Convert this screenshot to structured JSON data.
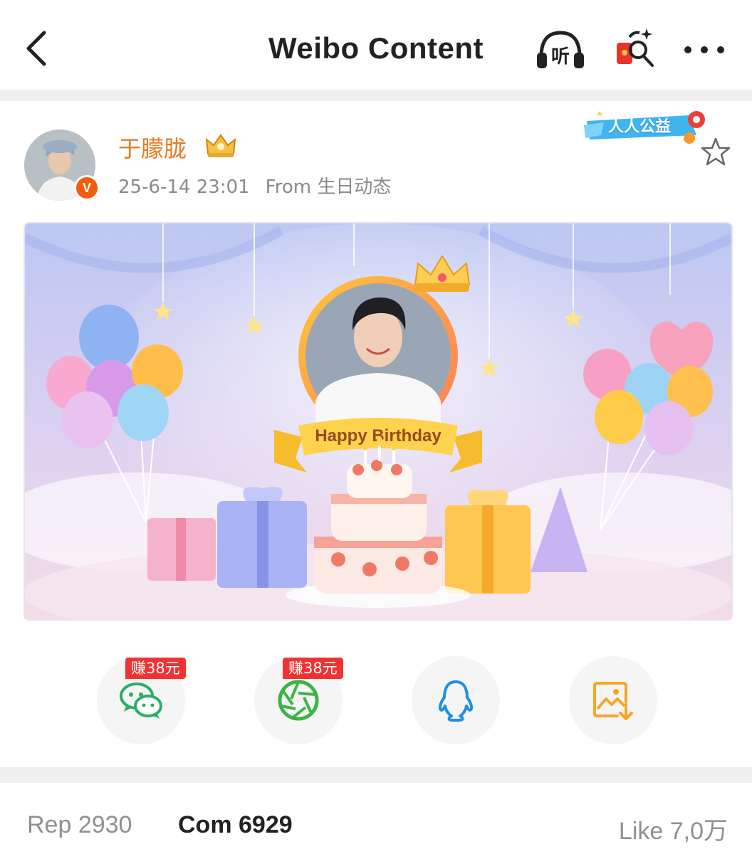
{
  "header": {
    "title": "Weibo Content",
    "listen_label": "听"
  },
  "post": {
    "author": "于朦胧",
    "timestamp": "25-6-14 23:01",
    "source": "From 生日动态",
    "verified_badge": "V",
    "charity_badge": "人人公益",
    "banner": {
      "title": "Happy Birthday"
    },
    "share": {
      "wechat_earn": "赚38元",
      "moments_earn": "赚38元"
    }
  },
  "stats": {
    "reposts": "Rep 2930",
    "comments": "Com 6929",
    "likes": "Like 7,0万"
  },
  "colors": {
    "username": "#eb7a22",
    "earn_badge": "#f23232",
    "wechat_green": "#2aae67",
    "qq_blue": "#1e8fe6",
    "save_orange": "#f5a623"
  }
}
